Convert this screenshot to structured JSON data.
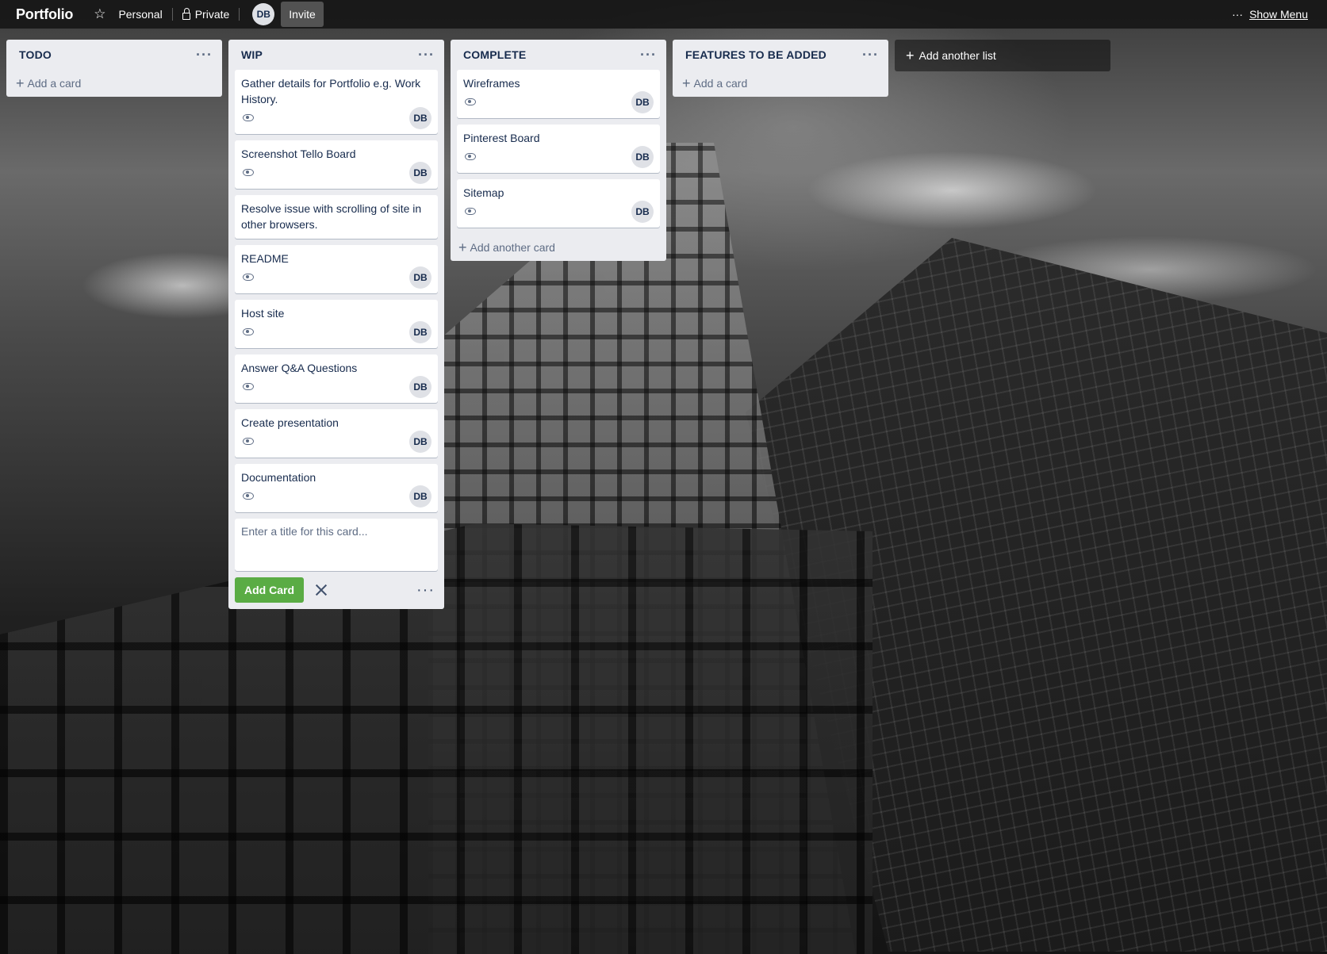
{
  "header": {
    "board_title": "Portfolio",
    "workspace": "Personal",
    "visibility": "Private",
    "member_initials": "DB",
    "invite_label": "Invite",
    "show_menu_label": "Show Menu"
  },
  "lists": [
    {
      "title": "TODO",
      "add_card_label": "Add a card"
    },
    {
      "title": "WIP",
      "cards": [
        {
          "title": "Gather details for Portfolio e.g. Work History.",
          "member": "DB"
        },
        {
          "title": "Screenshot Tello Board",
          "member": "DB"
        },
        {
          "title": "Resolve issue with scrolling of site in other browsers."
        },
        {
          "title": "README",
          "member": "DB"
        },
        {
          "title": "Host site",
          "member": "DB"
        },
        {
          "title": "Answer Q&A Questions",
          "member": "DB"
        },
        {
          "title": "Create presentation",
          "member": "DB"
        },
        {
          "title": "Documentation",
          "member": "DB"
        }
      ],
      "composer_placeholder": "Enter a title for this card...",
      "add_card_button": "Add Card"
    },
    {
      "title": "COMPLETE",
      "cards": [
        {
          "title": "Wireframes",
          "member": "DB"
        },
        {
          "title": "Pinterest Board",
          "member": "DB"
        },
        {
          "title": "Sitemap",
          "member": "DB"
        }
      ],
      "add_card_label": "Add another card"
    },
    {
      "title": "FEATURES TO BE ADDED",
      "add_card_label": "Add a card"
    }
  ],
  "add_list_label": "Add another list",
  "colors": {
    "list_bg": "#ebecf0",
    "add_button": "#5aac44",
    "text": "#172b4d"
  }
}
